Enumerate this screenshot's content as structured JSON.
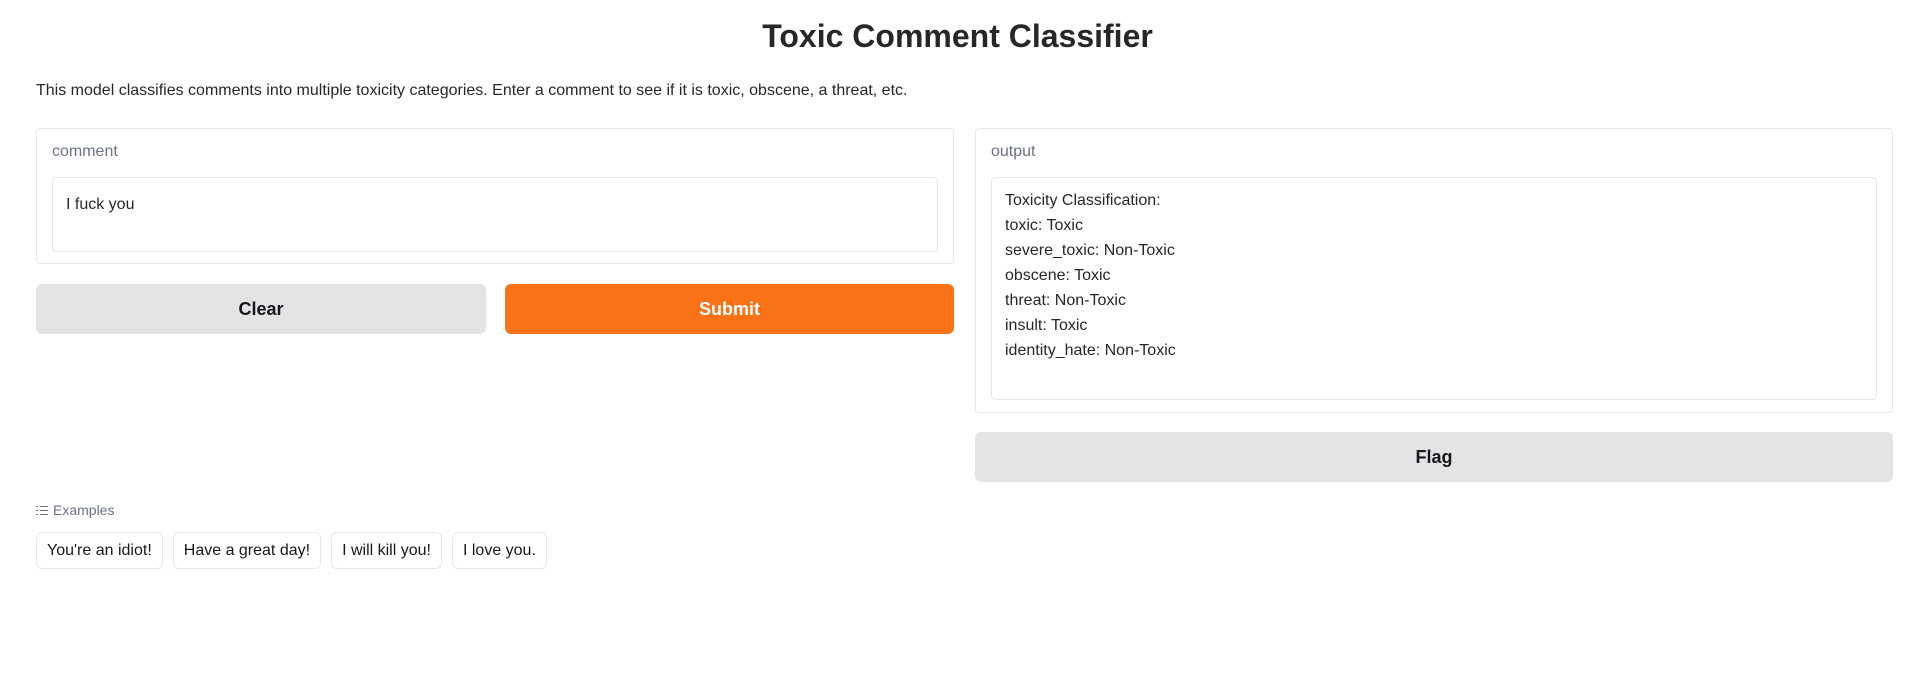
{
  "app": {
    "title": "Toxic Comment Classifier",
    "description": "This model classifies comments into multiple toxicity categories. Enter a comment to see if it is toxic, obscene, a threat, etc."
  },
  "input": {
    "label": "comment",
    "value": "I fuck you"
  },
  "output": {
    "label": "output",
    "lines": [
      "Toxicity Classification:",
      "toxic: Toxic",
      "severe_toxic: Non-Toxic",
      "obscene: Toxic",
      "threat: Non-Toxic",
      "insult: Toxic",
      "identity_hate: Non-Toxic"
    ]
  },
  "buttons": {
    "clear": "Clear",
    "submit": "Submit",
    "flag": "Flag"
  },
  "examples": {
    "header": "Examples",
    "icon": "list-icon",
    "items": [
      "You're an idiot!",
      "Have a great day!",
      "I will kill you!",
      "I love you."
    ]
  },
  "colors": {
    "primary": "#f97316",
    "secondary": "#e4e4e7"
  }
}
